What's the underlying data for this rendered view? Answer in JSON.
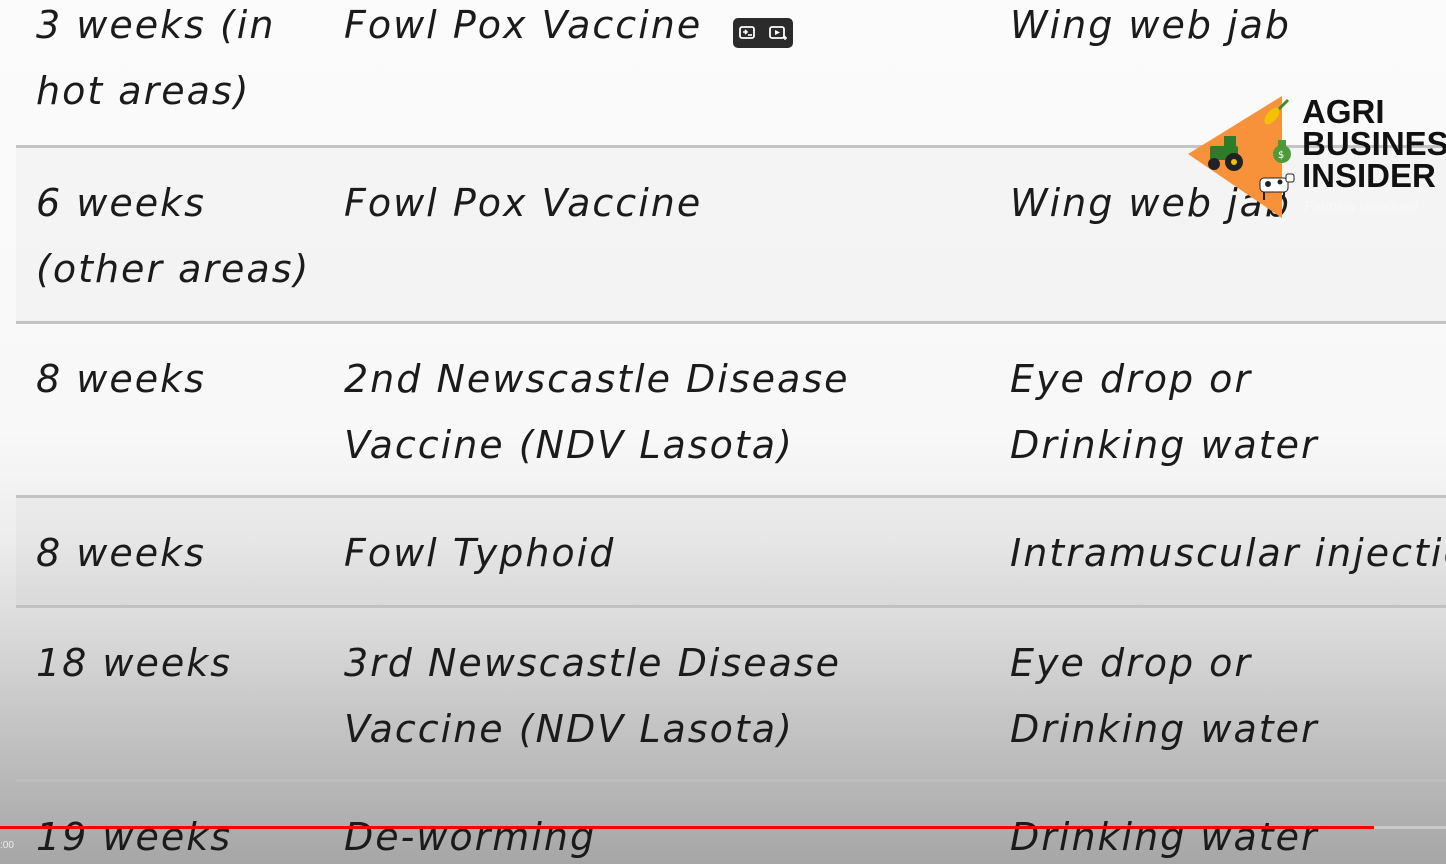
{
  "table": {
    "rows": [
      {
        "age": "3 weeks (in hot areas)",
        "vaccine": "Fowl Pox Vaccine",
        "method": "Wing web jab"
      },
      {
        "age": "6 weeks (other areas)",
        "vaccine": "Fowl Pox Vaccine",
        "method": "Wing web jab"
      },
      {
        "age": "8 weeks",
        "vaccine": "2nd Newscastle Disease Vaccine (NDV Lasota)",
        "method": "Eye drop or Drinking water"
      },
      {
        "age": "8 weeks",
        "vaccine": "Fowl Typhoid",
        "method": "Intramuscular injection"
      },
      {
        "age": "18 weeks",
        "vaccine": "3rd Newscastle Disease Vaccine (NDV Lasota)",
        "method": "Eye drop or Drinking water"
      },
      {
        "age": "19 weeks",
        "vaccine": "De-worming",
        "method": "Drinking water"
      }
    ]
  },
  "player": {
    "progress_fraction": 0.95,
    "time_label": ":00",
    "controls": {
      "left_icon": "swap-icon",
      "right_icon": "sparkle-play-icon"
    }
  },
  "logo": {
    "line1": "AGRI",
    "line2": "BUSINESS",
    "line3": "INSIDER",
    "tagline": "Farming redefined",
    "badge_color": "#f7923a"
  }
}
